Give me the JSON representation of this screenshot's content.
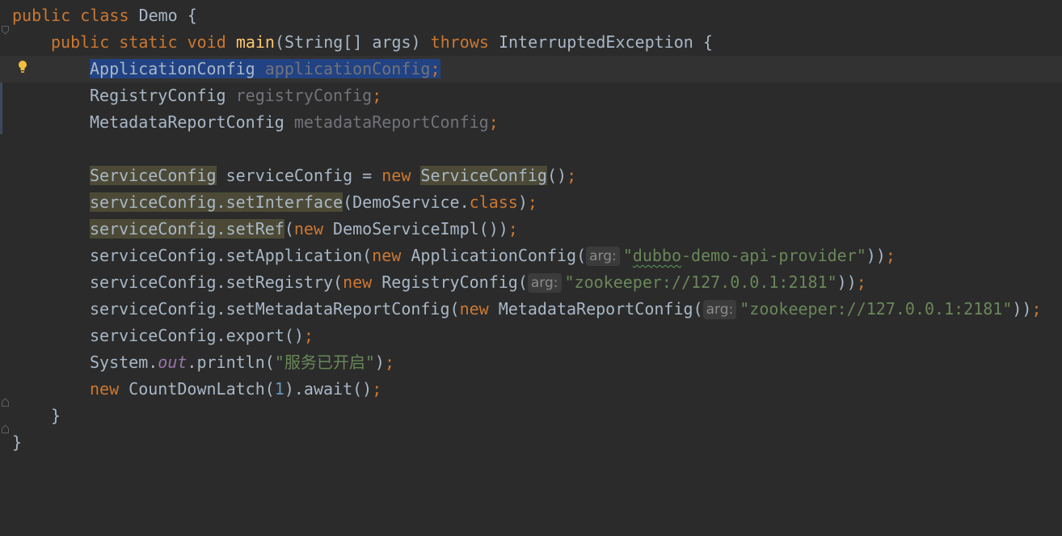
{
  "editor": {
    "l1": {
      "kw_public": "public",
      "kw_class": "class",
      "name": "Demo",
      "brace": "{"
    },
    "l2": {
      "kw_public": "public",
      "kw_static": "static",
      "kw_void": "void",
      "method": "main",
      "params": "(String[] args)",
      "kw_throws": "throws",
      "exception": "InterruptedException",
      "brace": "{"
    },
    "l3": {
      "type": "ApplicationConfig",
      "var": "applicationConfig",
      "semi": ";"
    },
    "l4": {
      "type": "RegistryConfig",
      "var": "registryConfig",
      "semi": ";"
    },
    "l5": {
      "type": "MetadataReportConfig",
      "var": "metadataReportConfig",
      "semi": ";"
    },
    "l7": {
      "type": "ServiceConfig",
      "rest": " serviceConfig = ",
      "kw_new": "new",
      "ctor": "ServiceConfig",
      "end": "()",
      "semi": ";"
    },
    "l8": {
      "call": "serviceConfig.setInterface",
      "arg": "(DemoService.",
      "kw_class": "class",
      "end": ")",
      "semi": ";"
    },
    "l9": {
      "call": "serviceConfig.setRef",
      "open": "(",
      "kw_new": "new",
      "arg": " DemoServiceImpl())",
      "semi": ";"
    },
    "l10": {
      "call": "serviceConfig.setApplication(",
      "kw_new": "new",
      "ctor": " ApplicationConfig(",
      "hint": "arg:",
      "str_q1": "\"",
      "str_word": "dubbo",
      "str_rest": "-demo-api-provider\"",
      "end": "))",
      "semi": ";"
    },
    "l11": {
      "call": "serviceConfig.setRegistry(",
      "kw_new": "new",
      "ctor": " RegistryConfig(",
      "hint": "arg:",
      "str": "\"zookeeper://127.0.0.1:2181\"",
      "end": "))",
      "semi": ";"
    },
    "l12": {
      "call": "serviceConfig.setMetadataReportConfig(",
      "kw_new": "new",
      "ctor": " MetadataReportConfig(",
      "hint": "arg:",
      "str": "\"zookeeper://127.0.0.1:2181\"",
      "end": "))",
      "semi": ";"
    },
    "l13": {
      "call": "serviceConfig.export()",
      "semi": ";"
    },
    "l14": {
      "obj": "System.",
      "field": "out",
      "call": ".println(",
      "str": "\"服务已开启\"",
      "end": ")",
      "semi": ";"
    },
    "l15": {
      "kw_new": "new",
      "ctor": " CountDownLatch(",
      "num": "1",
      "end": ").await()",
      "semi": ";"
    },
    "l16": {
      "brace": "}"
    },
    "l17": {
      "brace": "}"
    }
  },
  "colors": {
    "background": "#2b2b2b",
    "keyword": "#cc7832",
    "method_decl": "#ffc66d",
    "string": "#6a8759",
    "number": "#6897bb",
    "static_field": "#9876aa",
    "unused_var": "#72737a",
    "selection": "#214283",
    "usage_highlight": "#4c4a36"
  },
  "icons": {
    "intention": "lightbulb-icon",
    "fold": "fold-marker-icon"
  }
}
